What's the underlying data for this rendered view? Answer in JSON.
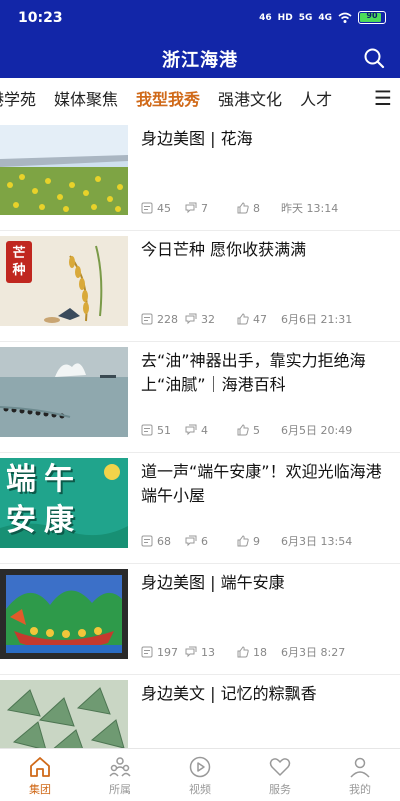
{
  "status": {
    "time": "10:23",
    "signal1": "46",
    "hd": "HD",
    "signal2": "5G",
    "signal3": "4G",
    "battery": "90"
  },
  "header": {
    "title": "浙江海港"
  },
  "tabs": [
    "港学苑",
    "媒体聚焦",
    "我型我秀",
    "强港文化",
    "人才"
  ],
  "active_tab": "我型我秀",
  "articles": [
    {
      "title": "身边美图 | 花海",
      "comments": "45",
      "shares": "7",
      "likes": "8",
      "time": "昨天 13:14"
    },
    {
      "title": "今日芒种 愿你收获满满",
      "comments": "228",
      "shares": "32",
      "likes": "47",
      "time": "6月6日 21:31",
      "thumb_text": "芒种"
    },
    {
      "title": "去“油”神器出手，靠实力拒绝海上“油腻”｜海港百科",
      "comments": "51",
      "shares": "4",
      "likes": "5",
      "time": "6月5日 20:49"
    },
    {
      "title": "道一声“端午安康”！欢迎光临海港端午小屋",
      "comments": "68",
      "shares": "6",
      "likes": "9",
      "time": "6月3日 13:54",
      "thumb_text": [
        "端午",
        "安康"
      ]
    },
    {
      "title": "身边美图 | 端午安康",
      "comments": "197",
      "shares": "13",
      "likes": "18",
      "time": "6月3日 8:27"
    },
    {
      "title": "身边美文 | 记忆的粽飘香"
    }
  ],
  "nav": [
    {
      "label": "集团",
      "icon": "home-icon",
      "active": true
    },
    {
      "label": "所属",
      "icon": "group-icon"
    },
    {
      "label": "视频",
      "icon": "video-icon"
    },
    {
      "label": "服务",
      "icon": "heart-icon"
    },
    {
      "label": "我的",
      "icon": "person-icon"
    }
  ],
  "colors": {
    "brand": "#1226a8",
    "accent": "#d06a1a"
  }
}
